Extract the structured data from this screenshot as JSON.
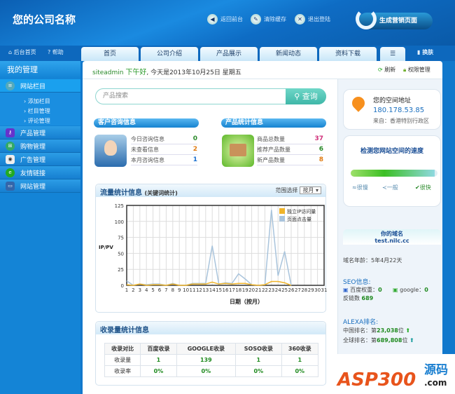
{
  "header": {
    "company": "您的公司名称",
    "actions": [
      {
        "label": "返回前台",
        "icon": "back-icon"
      },
      {
        "label": "清除缓存",
        "icon": "broom-icon"
      },
      {
        "label": "退出登陆",
        "icon": "logout-icon"
      }
    ],
    "generate": "生成营销页面"
  },
  "topbar": {
    "home": "后台首页",
    "help": "帮助",
    "skin": "换肤"
  },
  "tabs": [
    "首页",
    "公司介绍",
    "产品展示",
    "新闻动态",
    "资料下载"
  ],
  "sidebar": {
    "title": "我的管理",
    "items": [
      {
        "label": "网站栏目",
        "sub": [
          "添加栏目",
          "栏目管理",
          "评论管理"
        ]
      },
      {
        "label": "产品管理"
      },
      {
        "label": "购物管理"
      },
      {
        "label": "广告管理"
      },
      {
        "label": "友情链接"
      },
      {
        "label": "网站管理"
      }
    ]
  },
  "greeting": {
    "user": "siteadmin",
    "hello": "下午好",
    "date": ", 今天是2013年10月25日 星期五",
    "refresh": "刷新",
    "perm": "权限管理"
  },
  "search": {
    "placeholder": "产品搜索",
    "button": "查询"
  },
  "consult": {
    "title": "客户咨询信息",
    "rows": [
      {
        "label": "今日咨询信息",
        "value": "0",
        "color": "#2a8a2a"
      },
      {
        "label": "未查看信息",
        "value": "2",
        "color": "#e07a10"
      },
      {
        "label": "本月咨询信息",
        "value": "1",
        "color": "#1a6fd0"
      }
    ]
  },
  "products": {
    "title": "产品统计信息",
    "rows": [
      {
        "label": "商品总数量",
        "value": "37",
        "color": "#d0307a"
      },
      {
        "label": "推荐产品数量",
        "value": "6",
        "color": "#2a8a2a"
      },
      {
        "label": "新产品数量",
        "value": "8",
        "color": "#e07a10"
      }
    ]
  },
  "traffic": {
    "title": "流量统计信息",
    "subtitle": "(关键词统计)",
    "range_label": "范围选择",
    "range_value": "按月"
  },
  "chart_data": {
    "type": "line",
    "title": "流量统计信息",
    "xlabel": "日期（按月）",
    "ylabel": "IP/PV",
    "ylim": [
      0,
      125
    ],
    "yticks": [
      0,
      25,
      50,
      75,
      100,
      125
    ],
    "x": [
      1,
      2,
      3,
      4,
      5,
      6,
      7,
      8,
      9,
      10,
      11,
      12,
      13,
      14,
      15,
      16,
      17,
      18,
      19,
      20,
      21,
      22,
      23,
      24,
      25,
      26,
      27,
      28,
      29,
      30,
      31
    ],
    "grid": true,
    "legend": "top-right",
    "series": [
      {
        "name": "独立IP访问量",
        "color": "#f0b429",
        "values": [
          1,
          0,
          2,
          0,
          1,
          1,
          0,
          2,
          0,
          0,
          2,
          2,
          2,
          5,
          2,
          3,
          2,
          3,
          3,
          1,
          0,
          1,
          6,
          6,
          4,
          0,
          null,
          null,
          null,
          null,
          null
        ]
      },
      {
        "name": "页面点击量",
        "color": "#a9c4dc",
        "values": [
          7,
          0,
          2,
          1,
          2,
          2,
          0,
          3,
          0,
          0,
          3,
          3,
          3,
          62,
          2,
          4,
          3,
          18,
          10,
          1,
          0,
          1,
          118,
          15,
          53,
          0,
          null,
          null,
          null,
          null,
          null
        ]
      }
    ]
  },
  "index": {
    "title": "收录量统计信息",
    "headers": [
      "收录对比",
      "百度收录",
      "GOOGLE收录",
      "SOSO收录",
      "360收录"
    ],
    "rows": [
      [
        "收录量",
        "1",
        "139",
        "1",
        "1"
      ],
      [
        "收录率",
        "0%",
        "0%",
        "0%",
        "0%"
      ]
    ]
  },
  "space": {
    "title": "您的空间地址",
    "ip": "180.178.53.85",
    "from": "来自：香港特别行政区"
  },
  "speed": {
    "title": "检测您网站空间的速度",
    "level": 0.97,
    "labels": [
      "很慢",
      "一般",
      "很快"
    ]
  },
  "domain": {
    "title": "你的域名",
    "name": "test.nilc.cc",
    "age": "域名年龄：5年4月22天"
  },
  "seo": {
    "title": "SEO信息:",
    "baidu_label": "百度权重：",
    "baidu": "0",
    "google_label": "google：",
    "google": "0",
    "links_label": "反链数",
    "links": "689"
  },
  "alexa": {
    "title": "ALEXA排名:",
    "cn_label": "中国排名：第",
    "cn": "23,038",
    "global_label": "全球排名：第",
    "global": "689,808",
    "unit": "位"
  },
  "watermark": {
    "text": "ASP300",
    "cn": "源码",
    "com": ".com"
  }
}
